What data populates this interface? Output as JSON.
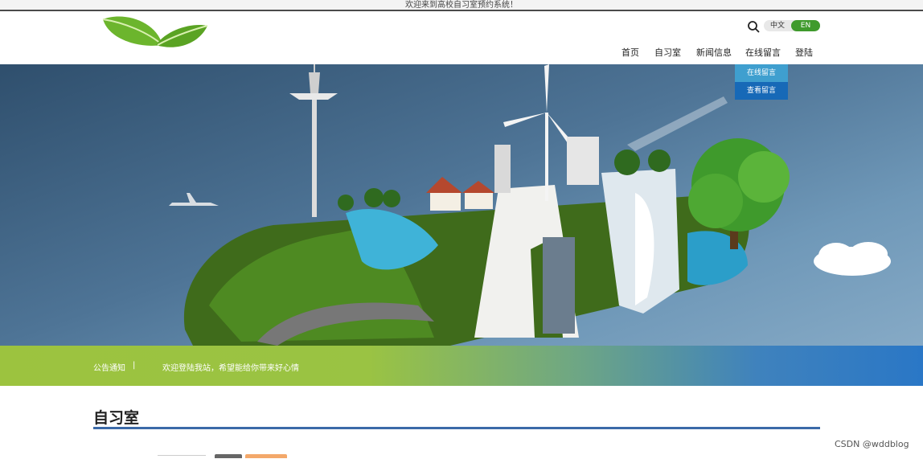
{
  "top_bar": {
    "welcome_text": "欢迎来到高校自习室预约系统！"
  },
  "header": {
    "logo_icon": "green-leaves-logo",
    "search_icon": "search-icon",
    "language": {
      "zh": "中文",
      "en": "EN",
      "active": "EN"
    }
  },
  "nav": {
    "items": [
      {
        "label": "首页"
      },
      {
        "label": "自习室"
      },
      {
        "label": "新闻信息"
      },
      {
        "label": "在线留言"
      },
      {
        "label": "登陆"
      }
    ],
    "dropdown": [
      "在线留言",
      "查看留言"
    ]
  },
  "notice": {
    "label": "公告通知",
    "separator": "|",
    "text": "欢迎登陆我站，希望能给你带来好心情"
  },
  "section": {
    "title": "自习室"
  },
  "watermark": "CSDN @wddblog",
  "colors": {
    "accent_green": "#3f9a2c",
    "dropdown_top": "#3f9fcf",
    "dropdown_bottom": "#1769b7",
    "section_line": "#3b6aa8",
    "notice_start": "#9cc33f",
    "notice_end": "#2a77c6"
  }
}
